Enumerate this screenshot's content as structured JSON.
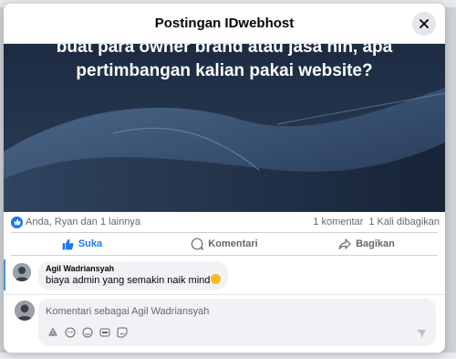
{
  "dialog": {
    "title": "Postingan IDwebhost"
  },
  "post": {
    "caption_line1": "buat para owner brand atau jasa nih, apa",
    "caption_line2": "pertimbangan kalian pakai website?"
  },
  "stats": {
    "reactions": "Anda, Ryan dan 1 lainnya",
    "comments": "1 komentar",
    "shares": "1 Kali dibagikan"
  },
  "actions": {
    "like": "Suka",
    "comment": "Komentari",
    "share": "Bagikan"
  },
  "comments": [
    {
      "author": "Agil Wadriansyah",
      "text": "biaya admin yang semakin naik mind"
    }
  ],
  "composer": {
    "placeholder": "Komentari sebagai Agil Wadriansyah"
  },
  "colors": {
    "accent": "#1877f2",
    "bubble": "#f0f2f5"
  },
  "icons": [
    "close-icon",
    "like-icon",
    "comment-icon",
    "share-icon",
    "sticker-icon",
    "avatar-icon",
    "emoji-icon",
    "gif-icon",
    "smile-sticker-icon",
    "send-icon"
  ]
}
